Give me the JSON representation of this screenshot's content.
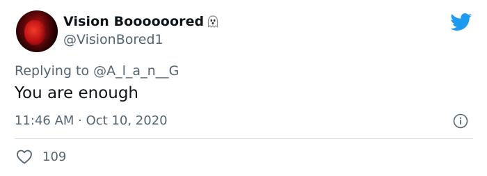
{
  "tweet": {
    "display_name": "Vision Boooooored",
    "handle": "@VisionBored1",
    "replying_prefix": "Replying to ",
    "replying_to": "@A_l_a_n__G",
    "text": "You are enough",
    "timestamp": "11:46 AM · Oct 10, 2020",
    "like_count": "109"
  },
  "icons": {
    "name_emoji": "ghost-icon",
    "brand": "twitter-bird-icon",
    "info": "info-icon",
    "like": "heart-icon"
  },
  "colors": {
    "brand": "#1d9bf0",
    "secondary_text": "#536471",
    "primary_text": "#0f1419",
    "divider": "#cfd9de"
  }
}
